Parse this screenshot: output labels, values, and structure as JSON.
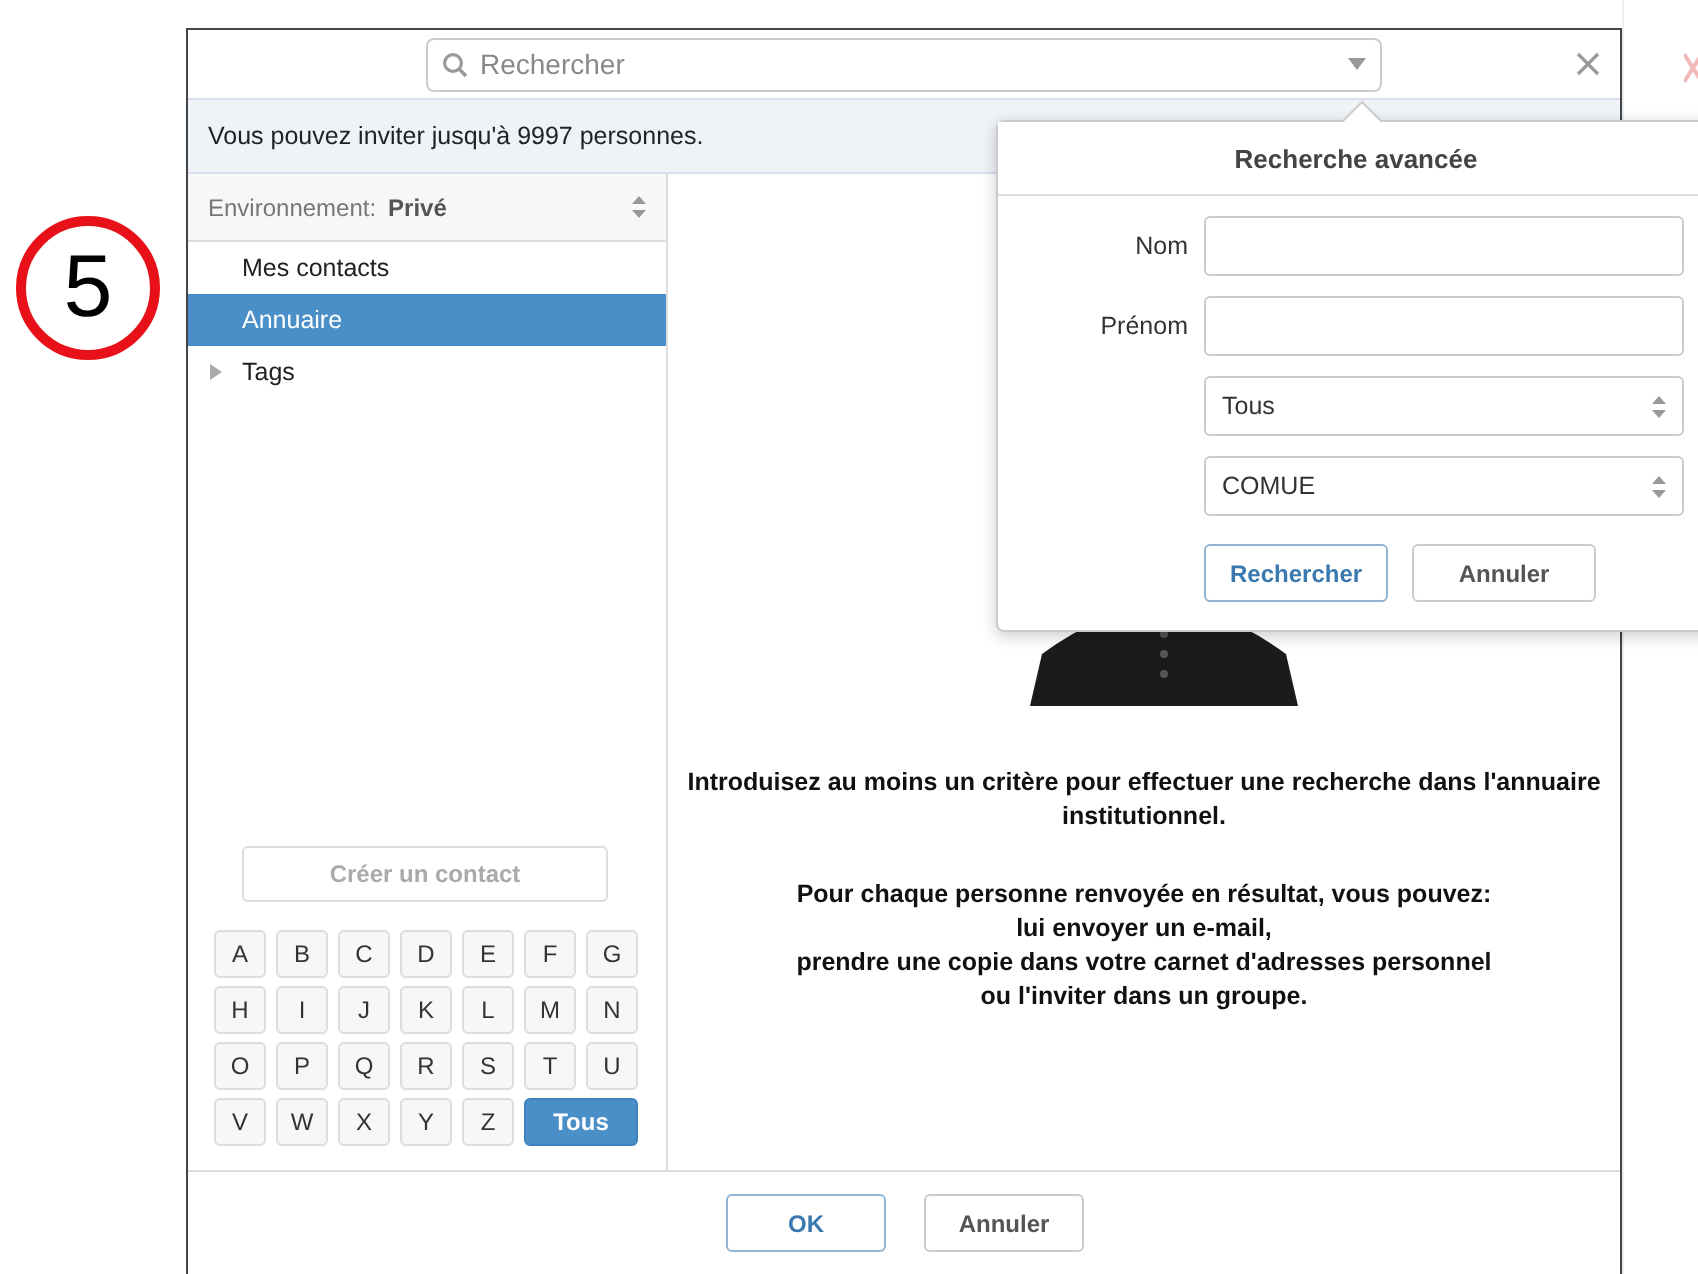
{
  "step_marker": "5",
  "search": {
    "placeholder": "Rechercher"
  },
  "info_bar": "Vous pouvez inviter jusqu'à 9997 personnes.",
  "environment": {
    "label": "Environnement:",
    "value": "Privé"
  },
  "sidebar": {
    "items": [
      {
        "label": "Mes contacts",
        "selected": false,
        "kind": "item"
      },
      {
        "label": "Annuaire",
        "selected": true,
        "kind": "item"
      },
      {
        "label": "Tags",
        "selected": false,
        "kind": "group",
        "expanded": false
      }
    ]
  },
  "create_contact": {
    "label": "Créer un contact",
    "disabled": true
  },
  "letters": [
    {
      "label": "A",
      "selected": false
    },
    {
      "label": "B",
      "selected": false
    },
    {
      "label": "C",
      "selected": false
    },
    {
      "label": "D",
      "selected": false
    },
    {
      "label": "E",
      "selected": false
    },
    {
      "label": "F",
      "selected": false
    },
    {
      "label": "G",
      "selected": false
    },
    {
      "label": "H",
      "selected": false
    },
    {
      "label": "I",
      "selected": false
    },
    {
      "label": "J",
      "selected": false
    },
    {
      "label": "K",
      "selected": false
    },
    {
      "label": "L",
      "selected": false
    },
    {
      "label": "M",
      "selected": false
    },
    {
      "label": "N",
      "selected": false
    },
    {
      "label": "O",
      "selected": false
    },
    {
      "label": "P",
      "selected": false
    },
    {
      "label": "Q",
      "selected": false
    },
    {
      "label": "R",
      "selected": false
    },
    {
      "label": "S",
      "selected": false
    },
    {
      "label": "T",
      "selected": false
    },
    {
      "label": "U",
      "selected": false
    },
    {
      "label": "V",
      "selected": false
    },
    {
      "label": "W",
      "selected": false
    },
    {
      "label": "X",
      "selected": false
    },
    {
      "label": "Y",
      "selected": false
    },
    {
      "label": "Z",
      "selected": false
    },
    {
      "label": "Tous",
      "selected": true
    }
  ],
  "help_text": [
    "Introduisez au moins un critère pour effectuer une recherche dans l'annuaire institutionnel.",
    "Pour chaque personne renvoyée en résultat, vous pouvez:\nlui envoyer un e-mail,\nprendre une copie dans votre carnet d'adresses personnel\nou l'inviter dans un groupe."
  ],
  "footer_buttons": [
    {
      "label": "OK",
      "kind": "primary"
    },
    {
      "label": "Annuler",
      "kind": "default"
    }
  ],
  "advanced_search": {
    "title": "Recherche avancée",
    "fields": [
      {
        "kind": "input",
        "label": "Nom"
      },
      {
        "kind": "input",
        "label": "Prénom"
      },
      {
        "kind": "select",
        "value": "Tous"
      },
      {
        "kind": "select",
        "value": "COMUE"
      }
    ],
    "buttons": [
      {
        "label": "Rechercher",
        "kind": "primary"
      },
      {
        "label": "Annuler",
        "kind": "default"
      }
    ]
  }
}
